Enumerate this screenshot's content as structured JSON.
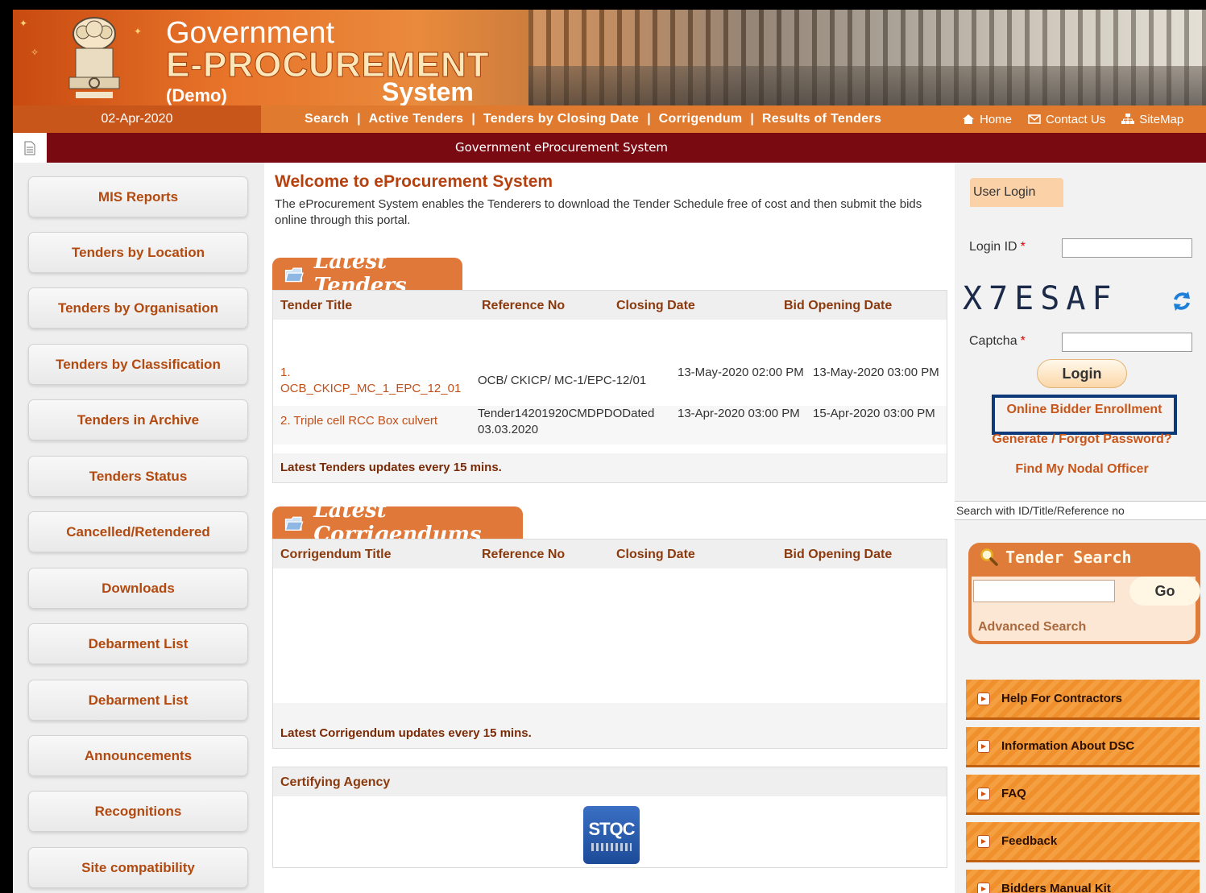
{
  "banner": {
    "line1": "Government",
    "line2": "E-PROCUREMENT",
    "line3": "(Demo)",
    "line4": "System"
  },
  "navbar": {
    "date": "02-Apr-2020",
    "links": [
      "Search",
      "Active Tenders",
      "Tenders by Closing Date",
      "Corrigendum",
      "Results of Tenders"
    ],
    "separator": "|",
    "quick": {
      "home": "Home",
      "contact": "Contact Us",
      "sitemap": "SiteMap"
    }
  },
  "strip": {
    "title": "Government eProcurement System"
  },
  "sidebar": {
    "items": [
      "MIS Reports",
      "Tenders by Location",
      "Tenders by Organisation",
      "Tenders by Classification",
      "Tenders in Archive",
      "Tenders Status",
      "Cancelled/Retendered",
      "Downloads",
      "Debarment List",
      "Debarment List",
      "Announcements",
      "Recognitions",
      "Site compatibility"
    ]
  },
  "main": {
    "welcome_title": "Welcome to eProcurement System",
    "welcome_text": "The eProcurement System enables the Tenderers to download the Tender Schedule free of cost and then submit the bids online through this portal.",
    "latest_tenders": {
      "tab": "Latest Tenders",
      "columns": [
        "Tender Title",
        "Reference No",
        "Closing Date",
        "Bid Opening Date"
      ],
      "rows": [
        {
          "title": "1. OCB_CKICP_MC_1_EPC_12_01",
          "ref": "OCB/ CKICP/ MC-1/EPC-12/01",
          "closing": "13-May-2020 02:00 PM",
          "opening": "13-May-2020 03:00 PM"
        },
        {
          "title": "2. Triple cell RCC Box culvert",
          "ref": "Tender14201920CMDPDODated 03.03.2020",
          "closing": "13-Apr-2020 03:00 PM",
          "opening": "15-Apr-2020 03:00 PM"
        }
      ],
      "footer": "Latest Tenders updates every 15 mins."
    },
    "latest_corrigendums": {
      "tab": "Latest Corrigendums",
      "columns": [
        "Corrigendum Title",
        "Reference No",
        "Closing Date",
        "Bid Opening Date"
      ],
      "footer": "Latest Corrigendum updates every 15 mins."
    },
    "certifying": {
      "title": "Certifying Agency",
      "logo_text": "STQC"
    }
  },
  "right": {
    "login_tab": "User Login",
    "login_id_label": "Login ID",
    "required_mark": "*",
    "captcha_text": "X7ESAF",
    "captcha_label": "Captcha",
    "login_button": "Login",
    "enroll_link": "Online Bidder Enrollment",
    "forgot_link": "Generate / Forgot Password?",
    "nodal_link": "Find My Nodal Officer",
    "search_hint": "Search with ID/Title/Reference no",
    "tender_search_title": "Tender Search",
    "go_button": "Go",
    "advanced_search": "Advanced Search",
    "help_items": [
      "Help For Contractors",
      "Information About DSC",
      "FAQ",
      "Feedback",
      "Bidders Manual Kit"
    ]
  }
}
